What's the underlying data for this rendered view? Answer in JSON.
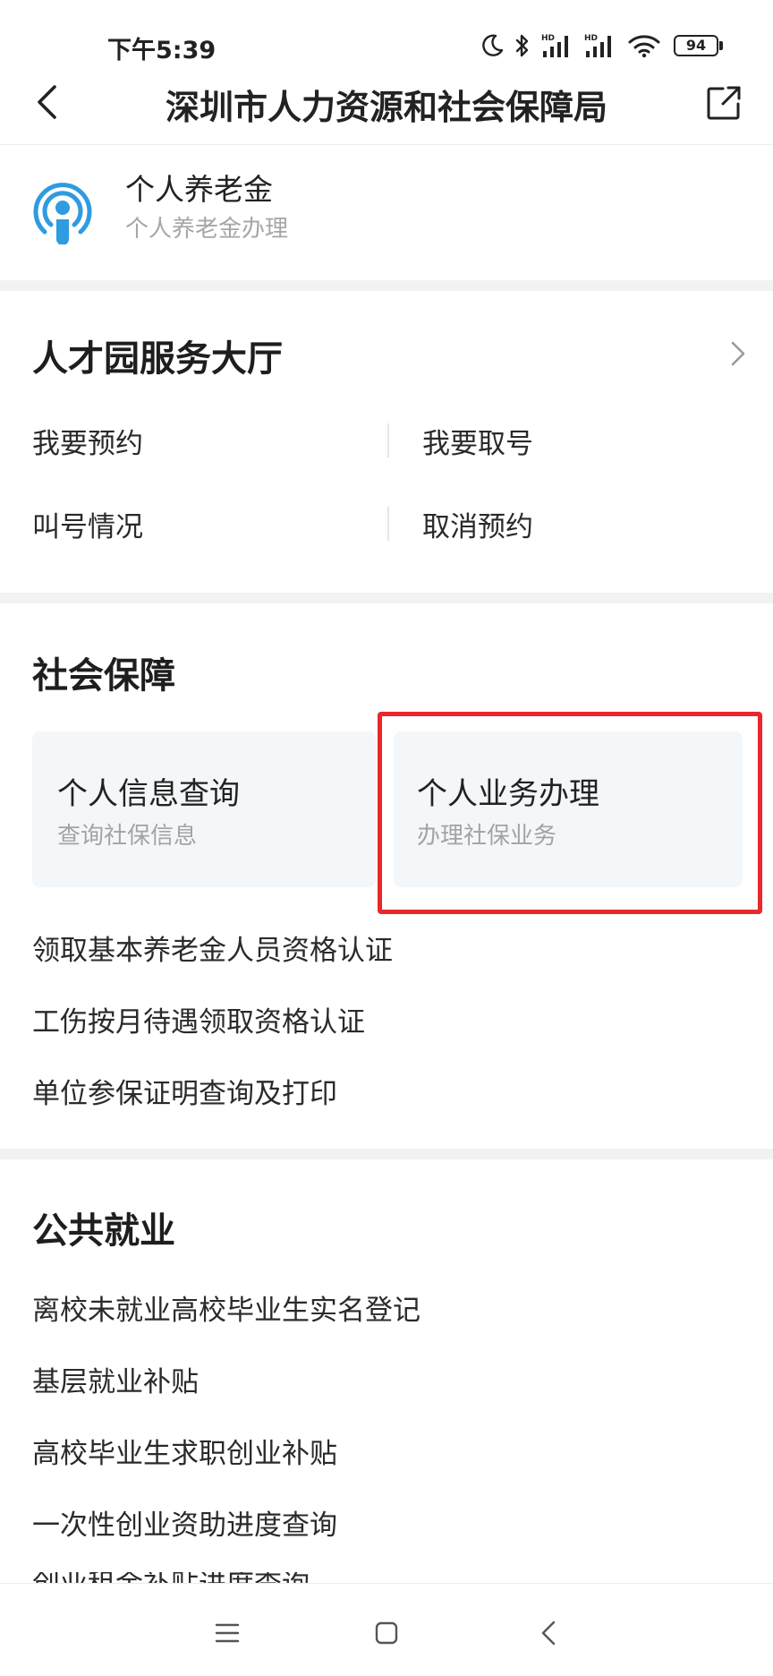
{
  "status_bar": {
    "time": "下午5:39",
    "battery": "94"
  },
  "nav": {
    "title": "深圳市人力资源和社会保障局"
  },
  "pension": {
    "title": "个人养老金",
    "subtitle": "个人养老金办理"
  },
  "talent_hall": {
    "title": "人才园服务大厅",
    "items": [
      "我要预约",
      "我要取号",
      "叫号情况",
      "取消预约"
    ]
  },
  "social_security": {
    "title": "社会保障",
    "cards": [
      {
        "title": "个人信息查询",
        "subtitle": "查询社保信息"
      },
      {
        "title": "个人业务办理",
        "subtitle": "办理社保业务"
      }
    ],
    "links": [
      "领取基本养老金人员资格认证",
      "工伤按月待遇领取资格认证",
      "单位参保证明查询及打印"
    ]
  },
  "employment": {
    "title": "公共就业",
    "links": [
      "离校未就业高校毕业生实名登记",
      "基层就业补贴",
      "高校毕业生求职创业补贴",
      "一次性创业资助进度查询",
      "创业租金补贴进度查询"
    ]
  },
  "colors": {
    "highlight": "#e8282a",
    "icon_blue": "#2f9be0",
    "card_bg": "#f4f7fa",
    "section_gap": "#f2f2f2"
  }
}
